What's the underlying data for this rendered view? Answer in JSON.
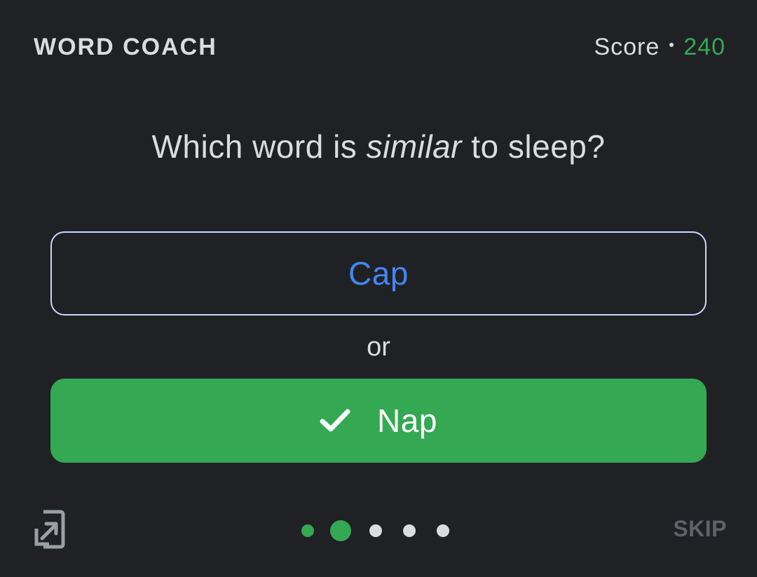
{
  "header": {
    "title": "WORD COACH",
    "score_label": "Score",
    "score_value": "240"
  },
  "question": {
    "prefix": "Which word is ",
    "emphasis": "similar",
    "suffix": " to sleep?"
  },
  "options": [
    {
      "label": "Cap",
      "state": "unselected"
    },
    {
      "label": "Nap",
      "state": "correct"
    }
  ],
  "separator": "or",
  "progress": {
    "total": 5,
    "completed": 1,
    "current": 2
  },
  "footer": {
    "skip_label": "SKIP",
    "share_icon": "share-icon"
  },
  "colors": {
    "background": "#202124",
    "accent_green": "#34a853",
    "option_text_blue": "#4285f4",
    "inactive_dot": "#dadce0"
  }
}
